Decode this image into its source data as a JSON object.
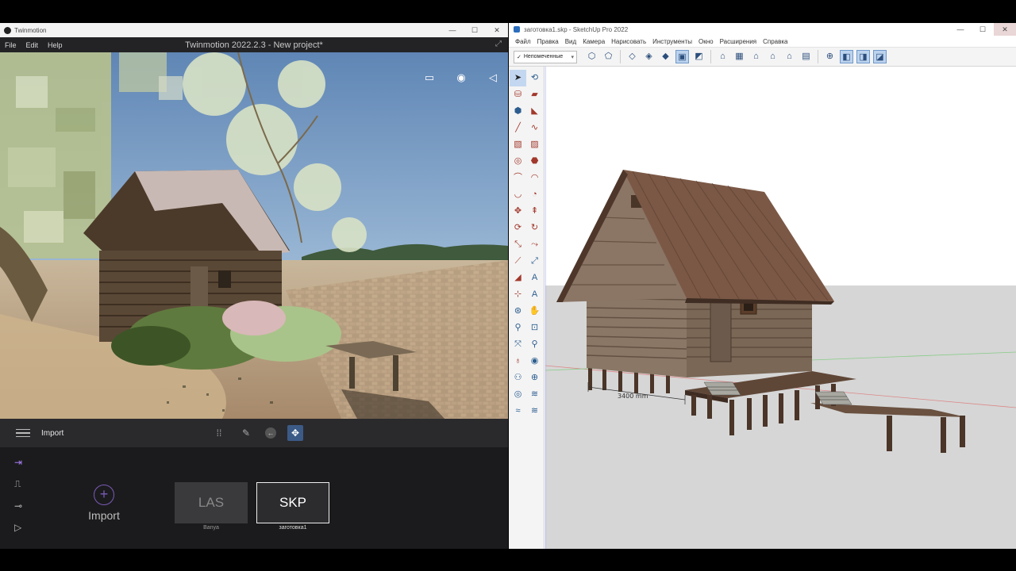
{
  "twinmotion": {
    "window_title": "Twinmotion",
    "menu": [
      "File",
      "Edit",
      "Help"
    ],
    "app_title": "Twinmotion 2022.2.3 - New project*",
    "toolbar": {
      "section_label": "Import"
    },
    "import_button": {
      "label": "Import"
    },
    "tiles": [
      {
        "label": "LAS",
        "caption": "Banya"
      },
      {
        "label": "SKP",
        "caption": "заготовка1"
      }
    ]
  },
  "sketchup": {
    "window_title": "заготовка1.skp - SketchUp Pro 2022",
    "menu": [
      "Файл",
      "Правка",
      "Вид",
      "Камера",
      "Нарисовать",
      "Инструменты",
      "Окно",
      "Расширения",
      "Справка"
    ],
    "tag_dropdown": "Непомеченные",
    "dimension": "3400 mm"
  },
  "colors": {
    "tm_bg": "#1f1f22",
    "tm_accent": "#7a5bb8",
    "su_sky": "#ffffff",
    "su_ground": "#d6d6d6"
  }
}
